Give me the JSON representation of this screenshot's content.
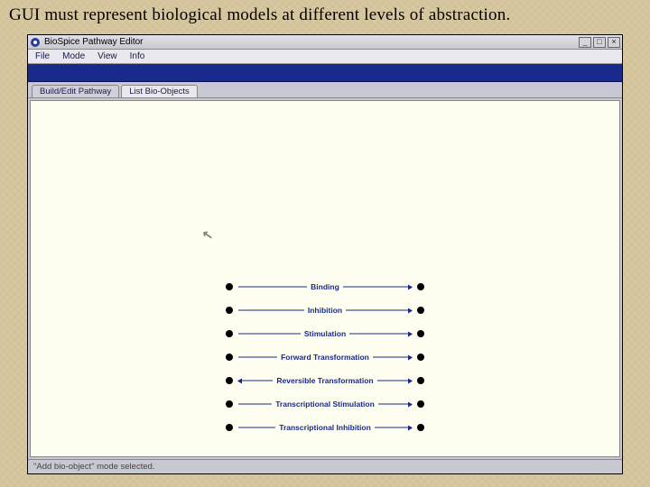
{
  "caption": "GUI must represent biological models at different levels of abstraction.",
  "window": {
    "title": "BioSpice Pathway Editor",
    "menu": {
      "file": "File",
      "mode": "Mode",
      "view": "View",
      "info": "Info"
    },
    "win": {
      "min": "_",
      "max": "□",
      "close": "×"
    },
    "tabs": {
      "build": "Build/Edit Pathway",
      "list": "List Bio-Objects"
    },
    "status": "\"Add bio-object\" mode selected."
  },
  "interactions": [
    {
      "label": "Binding",
      "double": false
    },
    {
      "label": "Inhibition",
      "double": false
    },
    {
      "label": "Stimulation",
      "double": false
    },
    {
      "label": "Forward Transformation",
      "double": false
    },
    {
      "label": "Reversible Transformation",
      "double": true
    },
    {
      "label": "Transcriptional Stimulation",
      "double": false
    },
    {
      "label": "Transcriptional Inhibition",
      "double": false
    }
  ]
}
